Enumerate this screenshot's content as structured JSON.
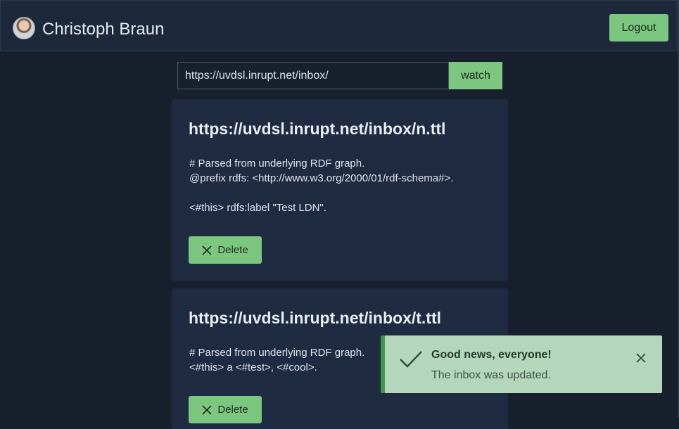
{
  "header": {
    "user_name": "Christoph Braun",
    "logout_label": "Logout"
  },
  "watch": {
    "url_value": "https://uvdsl.inrupt.net/inbox/",
    "button_label": "watch"
  },
  "cards": [
    {
      "title": "https://uvdsl.inrupt.net/inbox/n.ttl",
      "body": "# Parsed from underlying RDF graph.\n@prefix rdfs: <http://www.w3.org/2000/01/rdf-schema#>.\n\n<#this> rdfs:label \"Test LDN\".",
      "delete_label": "Delete"
    },
    {
      "title": "https://uvdsl.inrupt.net/inbox/t.ttl",
      "body": "# Parsed from underlying RDF graph.\n<#this> a <#test>, <#cool>.",
      "delete_label": "Delete"
    }
  ],
  "toast": {
    "title": "Good news, everyone!",
    "message": "The inbox was updated."
  },
  "icons": {
    "delete": "close-icon",
    "toast_status": "check-icon",
    "toast_close": "close-icon"
  },
  "colors": {
    "accent": "#7cc77f",
    "background": "#18202e",
    "card": "#1e2b40",
    "toast": "#b4d6ba",
    "toast_border": "#3f9450"
  }
}
